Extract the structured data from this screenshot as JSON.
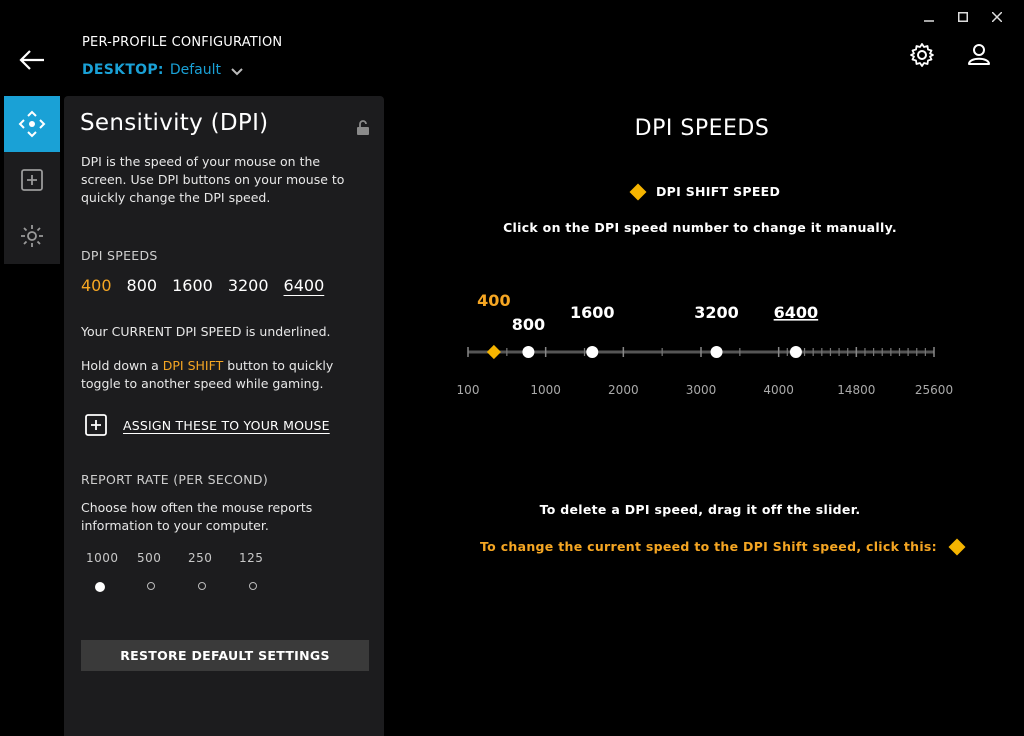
{
  "window": {
    "minimize_icon": "minimize-icon",
    "maximize_icon": "maximize-icon",
    "close_icon": "close-icon"
  },
  "header": {
    "section_title": "PER-PROFILE CONFIGURATION",
    "profile_keyword": "DESKTOP:",
    "profile_name": "Default"
  },
  "panel": {
    "title": "Sensitivity (DPI)",
    "description": "DPI is the speed of your mouse on the screen. Use DPI buttons on your mouse to quickly change the DPI speed.",
    "dpi_label": "DPI SPEEDS",
    "dpi_values": [
      "400",
      "800",
      "1600",
      "3200",
      "6400"
    ],
    "current_note": "Your CURRENT DPI SPEED is underlined.",
    "shift_note_pre": "Hold down a ",
    "shift_note_highlight": "DPI SHIFT",
    "shift_note_post": " button to quickly toggle to another speed while gaming.",
    "assign_label": "ASSIGN THESE TO YOUR MOUSE",
    "report_label": "REPORT RATE (PER SECOND)",
    "report_desc": "Choose how often the mouse reports information to your computer.",
    "report_rates": [
      "1000",
      "500",
      "250",
      "125"
    ],
    "report_selected": "1000",
    "restore_label": "RESTORE DEFAULT SETTINGS"
  },
  "main": {
    "title": "DPI SPEEDS",
    "shift_legend": "DPI SHIFT SPEED",
    "hint_manual": "Click on the DPI speed number to change it manually.",
    "hint_delete": "To delete a DPI speed, drag it off the slider.",
    "hint_shift": "To change the current speed to the DPI Shift speed, click this:"
  },
  "slider": {
    "scale_labels": [
      "100",
      "1000",
      "2000",
      "3000",
      "4000",
      "14800",
      "25600"
    ],
    "markers": [
      {
        "label": "400",
        "shift": true,
        "current": false
      },
      {
        "label": "800",
        "shift": false,
        "current": false
      },
      {
        "label": "1600",
        "shift": false,
        "current": false
      },
      {
        "label": "3200",
        "shift": false,
        "current": false
      },
      {
        "label": "6400",
        "shift": false,
        "current": true
      }
    ]
  },
  "colors": {
    "accent": "#1aa1d6",
    "shift": "#f5b400",
    "panel_bg": "#1c1c1e"
  }
}
